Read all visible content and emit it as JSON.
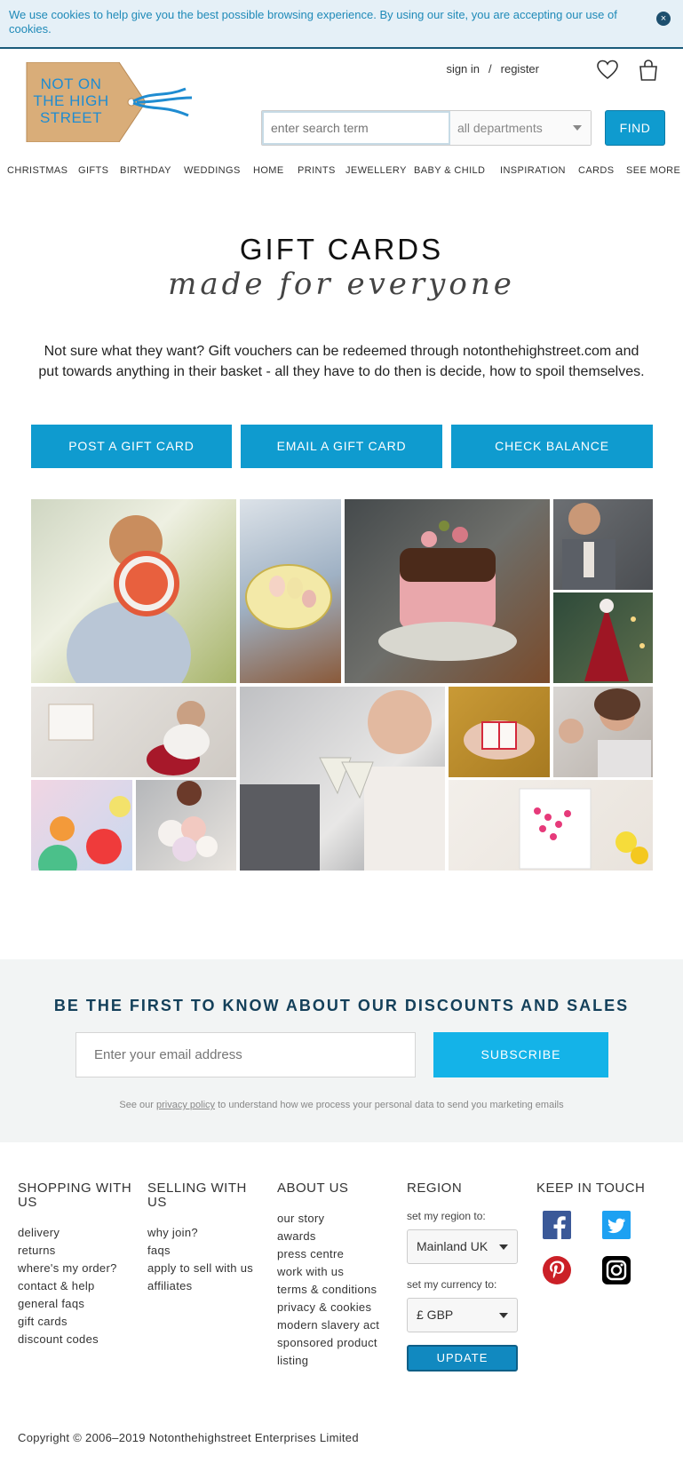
{
  "cookie": {
    "text": "We use cookies to help give you the best possible browsing experience. By using our site, you are accepting our use of cookies.",
    "close_symbol": "×"
  },
  "logo": {
    "line1": "NOT ON",
    "line2": "THE HIGH",
    "line3": "STREET"
  },
  "header": {
    "sign_in": "sign in",
    "separator": "/",
    "register": "register",
    "search_placeholder": "enter search term",
    "department": "all departments",
    "find": "FIND"
  },
  "nav": [
    "CHRISTMAS",
    "GIFTS",
    "BIRTHDAY",
    "WEDDINGS",
    "HOME",
    "PRINTS",
    "JEWELLERY",
    "BABY & CHILD",
    "INSPIRATION",
    "CARDS",
    "SEE MORE"
  ],
  "hero": {
    "title": "GIFT CARDS",
    "script": "made for everyone",
    "description": "Not sure what they want? Gift vouchers can be redeemed through notonthehighstreet.com and put towards anything in their basket - all they have to do then is decide, how to spoil themselves."
  },
  "ctas": [
    "POST A GIFT CARD",
    "EMAIL A GIFT CARD",
    "CHECK BALANCE"
  ],
  "newsletter": {
    "title": "BE THE FIRST TO KNOW ABOUT OUR DISCOUNTS AND SALES",
    "placeholder": "Enter your email address",
    "button": "SUBSCRIBE",
    "note_pre": "See our",
    "note_link": "privacy policy",
    "note_post": "to understand how we process your personal data to send you marketing emails"
  },
  "footer": {
    "shopping": {
      "title": "SHOPPING WITH US",
      "links": [
        "delivery",
        "returns",
        "where's my order?",
        "contact & help",
        "general faqs",
        "gift cards",
        "discount codes"
      ]
    },
    "selling": {
      "title": "SELLING WITH US",
      "links": [
        "why join?",
        "faqs",
        "apply to sell with us",
        "affiliates"
      ]
    },
    "about": {
      "title": "ABOUT US",
      "links": [
        "our story",
        "awards",
        "press centre",
        "work with us",
        "terms & conditions",
        "privacy & cookies",
        "modern slavery act",
        "sponsored product listing"
      ]
    },
    "region": {
      "title": "REGION",
      "region_label": "set my region to:",
      "region_value": "Mainland UK",
      "currency_label": "set my currency to:",
      "currency_value": "£ GBP",
      "update": "UPDATE"
    },
    "keep_in_touch": {
      "title": "KEEP IN TOUCH",
      "facebook_color": "#3b5998",
      "twitter_color": "#1da1f2",
      "pinterest_color": "#cb2027",
      "instagram_color": "#000000"
    },
    "copyright": "Copyright © 2006–2019 Notonthehighstreet Enterprises Limited"
  },
  "colors": {
    "accent": "#0f9bcf",
    "subscribe": "#14b3e8",
    "newsletter_title": "#14405a"
  }
}
